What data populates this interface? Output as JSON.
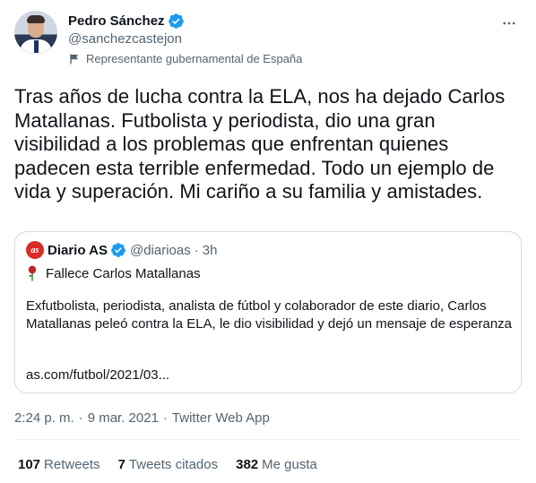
{
  "author": {
    "name": "Pedro Sánchez",
    "handle": "@sanchezcastejon",
    "label": "Representante gubernamental de España"
  },
  "tweet": {
    "text": "Tras años de lucha contra la ELA, nos ha dejado Carlos Matallanas. Futbolista y periodista, dio una gran visibilidad a los problemas que enfrentan quienes padecen esta terrible enfermedad. Todo un ejemplo de vida y superación. Mi cariño a su familia y amistades.",
    "time": "2:24 p. m.",
    "date": "9 mar. 2021",
    "separator": "·",
    "source": "Twitter Web App"
  },
  "quote": {
    "logo_text": "as",
    "name": "Diario AS",
    "handle": "@diarioas",
    "dot": "·",
    "time": "3h",
    "title": "Fallece Carlos Matallanas",
    "body": "Exfutbolista, periodista, analista de fútbol y colaborador de este diario, Carlos Matallanas peleó contra la ELA, le dio visibilidad y dejó un mensaje de esperanza",
    "link": "as.com/futbol/2021/03..."
  },
  "stats": {
    "retweets_count": "107",
    "retweets_label": "Retweets",
    "quotes_count": "7",
    "quotes_label": "Tweets citados",
    "likes_count": "382",
    "likes_label": "Me gusta"
  },
  "icons": {
    "verified": "verified-badge-icon",
    "more": "more-icon",
    "flag": "flag-icon",
    "rose": "rose-icon"
  },
  "colors": {
    "verified": "#1d9bf0",
    "secondary_text": "#536471",
    "border": "#cfd9de",
    "as_brand": "#d92c27"
  }
}
